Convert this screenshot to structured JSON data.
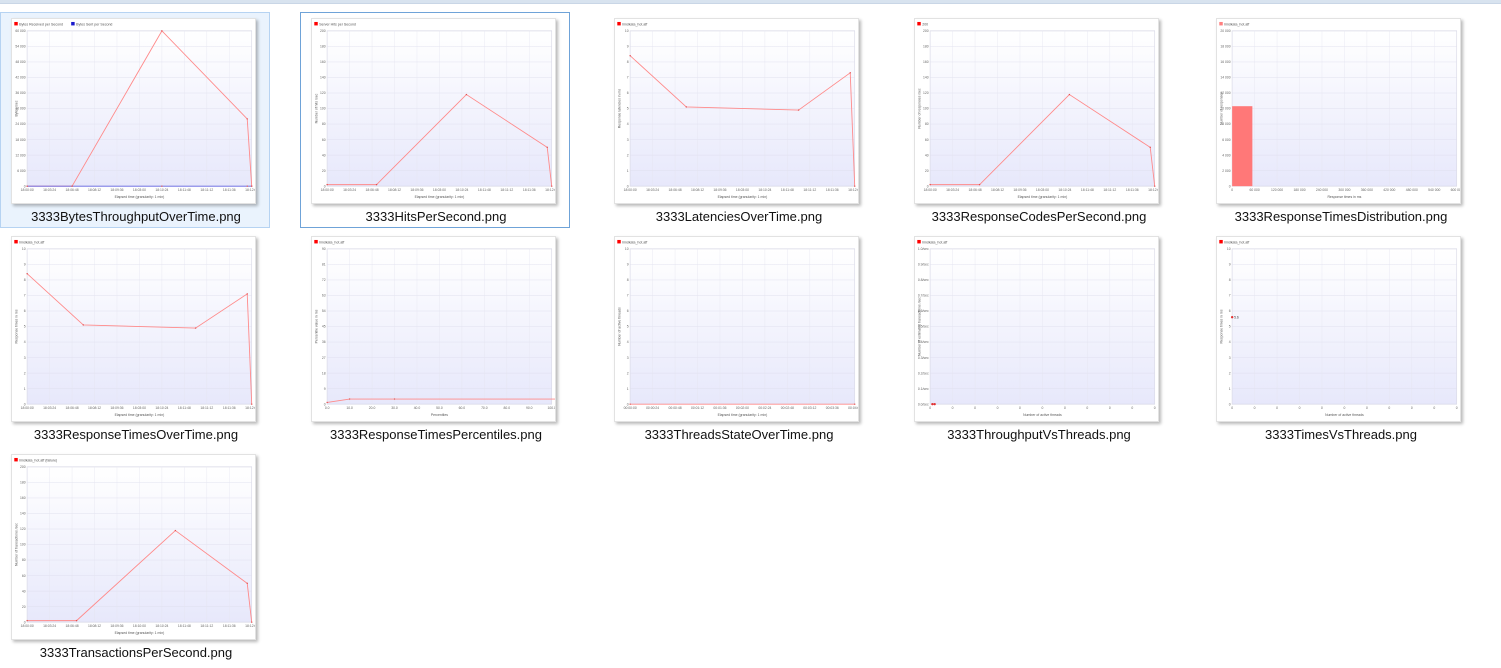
{
  "files": [
    {
      "name": "3333BytesThroughputOverTime.png",
      "state": "selected",
      "chart": {
        "legend": [
          "Bytes Received per Second",
          "Bytes Sent per Second"
        ],
        "legend_colors": [
          "#ff0000",
          "#1a1acc"
        ],
        "y_ticks": [
          "60 000",
          "54 000",
          "48 000",
          "42 000",
          "36 000",
          "30 000",
          "24 000",
          "18 000",
          "12 000",
          "6 000",
          "0"
        ],
        "x_ticks": [
          "18:00:00",
          "18:03:24",
          "18:06:48",
          "18:08:12",
          "18:09:36",
          "18:03:00",
          "18:10:24",
          "18:11:48",
          "18:11:12",
          "18:11:36",
          "18:12:00"
        ],
        "xlabel": "Elapsed time (granularity: 1 min)",
        "ylabel": "Bytes /sec",
        "ymax": 60000,
        "series": [
          {
            "color": "#ff8a8a",
            "x": [
              0,
              2,
              6,
              9.8,
              10
            ],
            "y": [
              0,
              0,
              60000,
              26000,
              0
            ]
          },
          {
            "color": "#6060e0",
            "x": [
              0,
              2,
              6,
              9.8,
              10
            ],
            "y": [
              0,
              0,
              0,
              0,
              0
            ]
          }
        ]
      }
    },
    {
      "name": "3333HitsPerSecond.png",
      "state": "focused",
      "chart": {
        "legend": [
          "Server Hits per Second"
        ],
        "legend_colors": [
          "#ff0000"
        ],
        "y_ticks": [
          "200",
          "180",
          "160",
          "140",
          "120",
          "100",
          "80",
          "60",
          "40",
          "20",
          "0"
        ],
        "x_ticks": [
          "18:00:00",
          "18:03:24",
          "18:06:48",
          "18:08:12",
          "18:09:36",
          "18:03:00",
          "18:10:24",
          "18:11:48",
          "18:11:12",
          "18:11:36",
          "18:12:00"
        ],
        "xlabel": "Elapsed time (granularity: 1 min)",
        "ylabel": "Number of hits /sec",
        "ymax": 200,
        "series": [
          {
            "color": "#ff8a8a",
            "x": [
              0,
              2.2,
              6.2,
              9.8,
              10
            ],
            "y": [
              2,
              2,
              118,
              50,
              0
            ]
          }
        ]
      }
    },
    {
      "name": "3333LatenciesOverTime.png",
      "state": "none",
      "chart": {
        "legend": [
          "limdkata_hot.aff"
        ],
        "legend_colors": [
          "#ff0000"
        ],
        "y_ticks": [
          "10",
          "9",
          "8",
          "7",
          "6",
          "5",
          "4",
          "3",
          "2",
          "1",
          "0"
        ],
        "x_ticks": [
          "18:00:00",
          "18:03:24",
          "18:06:48",
          "18:08:12",
          "18:09:36",
          "18:03:00",
          "18:10:24",
          "18:11:48",
          "18:11:12",
          "18:11:36",
          "18:12:00"
        ],
        "xlabel": "Elapsed time (granularity: 1 min)",
        "ylabel": "Response latencies in ms",
        "ymax": 10,
        "series": [
          {
            "color": "#ff8a8a",
            "x": [
              0,
              2.5,
              7.5,
              9.8,
              10
            ],
            "y": [
              8.4,
              5.1,
              4.9,
              7.3,
              0
            ]
          }
        ]
      }
    },
    {
      "name": "3333ResponseCodesPerSecond.png",
      "state": "none",
      "chart": {
        "legend": [
          "200"
        ],
        "legend_colors": [
          "#ff0000"
        ],
        "y_ticks": [
          "200",
          "180",
          "160",
          "140",
          "120",
          "100",
          "80",
          "60",
          "40",
          "20",
          "0"
        ],
        "x_ticks": [
          "18:00:00",
          "18:03:24",
          "18:06:48",
          "18:08:12",
          "18:09:36",
          "18:03:00",
          "18:10:24",
          "18:11:48",
          "18:11:12",
          "18:11:36",
          "18:12:00"
        ],
        "xlabel": "Elapsed time (granularity: 1 min)",
        "ylabel": "Number of responses /sec",
        "ymax": 200,
        "series": [
          {
            "color": "#ff8a8a",
            "x": [
              0,
              2.2,
              6.2,
              9.8,
              10
            ],
            "y": [
              2,
              2,
              118,
              50,
              0
            ]
          }
        ]
      }
    },
    {
      "name": "3333ResponseTimesDistribution.png",
      "state": "none",
      "chart": {
        "legend": [
          "limdkata_hot.aff"
        ],
        "legend_colors": [
          "#ff8080"
        ],
        "y_ticks": [
          "20 000",
          "18 000",
          "16 000",
          "14 000",
          "12 000",
          "10 000",
          "8 000",
          "6 000",
          "4 000",
          "2 000",
          "0"
        ],
        "x_ticks": [
          "0",
          "60 000",
          "120 000",
          "180 000",
          "240 000",
          "300 000",
          "360 000",
          "420 000",
          "480 000",
          "540 000",
          "600 000"
        ],
        "xlabel": "Response times in ms",
        "ylabel": "Number of responses",
        "ymax": 20000,
        "bar": {
          "x0": 0,
          "x1": 0.9,
          "value": 10300
        }
      }
    },
    {
      "name": "3333ResponseTimesOverTime.png",
      "state": "none",
      "chart": {
        "legend": [
          "limdkata_hot.aff"
        ],
        "legend_colors": [
          "#ff0000"
        ],
        "y_ticks": [
          "10",
          "9",
          "8",
          "7",
          "6",
          "5",
          "4",
          "3",
          "2",
          "1",
          "0"
        ],
        "x_ticks": [
          "18:00:00",
          "18:03:24",
          "18:06:48",
          "18:08:12",
          "18:09:36",
          "18:03:00",
          "18:10:24",
          "18:11:48",
          "18:11:12",
          "18:11:36",
          "18:12:00"
        ],
        "xlabel": "Elapsed time (granularity: 1 min)",
        "ylabel": "Response times in ms",
        "ymax": 10,
        "series": [
          {
            "color": "#ff8a8a",
            "x": [
              0,
              2.5,
              7.5,
              9.8,
              10
            ],
            "y": [
              8.4,
              5.1,
              4.9,
              7.1,
              0
            ]
          }
        ]
      }
    },
    {
      "name": "3333ResponseTimesPercentiles.png",
      "state": "none",
      "chart": {
        "legend": [
          "limdkata_hot.aff"
        ],
        "legend_colors": [
          "#ff0000"
        ],
        "y_ticks": [
          "90",
          "81",
          "72",
          "63",
          "54",
          "45",
          "36",
          "27",
          "18",
          "9",
          "0"
        ],
        "x_ticks": [
          "0.0",
          "10.0",
          "20.0",
          "30.0",
          "40.0",
          "50.0",
          "60.0",
          "70.0",
          "80.0",
          "90.0",
          "100.0"
        ],
        "xlabel": "Percentiles",
        "ylabel": "Percentile value in ms",
        "ymax": 90,
        "series": [
          {
            "color": "#ff8a8a",
            "x": [
              0,
              1,
              3,
              27,
              28,
              79,
              80,
              97,
              99,
              99.6,
              100
            ],
            "y": [
              1,
              3,
              3,
              3,
              4,
              4,
              5,
              5,
              10,
              86,
              0
            ]
          }
        ]
      }
    },
    {
      "name": "3333ThreadsStateOverTime.png",
      "state": "none",
      "chart": {
        "legend": [
          "limdkata_hot.aff"
        ],
        "legend_colors": [
          "#ff0000"
        ],
        "y_ticks": [
          "10",
          "9",
          "8",
          "7",
          "6",
          "5",
          "4",
          "3",
          "2",
          "1",
          "0"
        ],
        "x_ticks": [
          "00:00:00",
          "00:00:24",
          "00:00:48",
          "00:01:12",
          "00:01:36",
          "00:02:00",
          "00:02:24",
          "00:02:48",
          "00:03:12",
          "00:03:36",
          "00:04:00"
        ],
        "xlabel": "Elapsed time (granularity: 1 min)",
        "ylabel": "Number of active threads",
        "ymax": 10,
        "series": [
          {
            "color": "#ff8a8a",
            "x": [
              0,
              10
            ],
            "y": [
              0,
              0
            ]
          }
        ]
      }
    },
    {
      "name": "3333ThroughputVsThreads.png",
      "state": "none",
      "chart": {
        "legend": [
          "limdkata_hot.aff"
        ],
        "legend_colors": [
          "#ff0000"
        ],
        "y_ticks": [
          "1.0/sec",
          "0.9/sec",
          "0.8/sec",
          "0.7/sec",
          "0.6/sec",
          "0.5/sec",
          "0.4/sec",
          "0.3/sec",
          "0.2/sec",
          "0.1/sec",
          "0.0/sec"
        ],
        "x_ticks": [
          "0",
          "0",
          "0",
          "0",
          "0",
          "0",
          "0",
          "0",
          "0",
          "0",
          "0"
        ],
        "xlabel": "Number of active threads",
        "ylabel": "Number of estimated transactions /sec",
        "ymax": 10,
        "points": [
          {
            "x": 0.1,
            "y": 0
          },
          {
            "x": 0.2,
            "y": 0
          }
        ]
      }
    },
    {
      "name": "3333TimesVsThreads.png",
      "state": "none",
      "chart": {
        "legend": [
          "limdkata_hot.aff"
        ],
        "legend_colors": [
          "#ff0000"
        ],
        "y_ticks": [
          "10",
          "9",
          "8",
          "7",
          "6",
          "5",
          "4",
          "3",
          "2",
          "1",
          "0"
        ],
        "x_ticks": [
          "0",
          "0",
          "0",
          "0",
          "0",
          "0",
          "0",
          "0",
          "0",
          "0",
          "0"
        ],
        "xlabel": "Number of active threads",
        "ylabel": "Response times in ms",
        "ymax": 10,
        "points": [
          {
            "x": 0,
            "y": 5.6,
            "label": "5.6"
          }
        ]
      }
    },
    {
      "name": "3333TransactionsPerSecond.png",
      "state": "none",
      "chart": {
        "legend": [
          "limdkata_hot.aff (failure)"
        ],
        "legend_colors": [
          "#ff0000"
        ],
        "y_ticks": [
          "200",
          "180",
          "160",
          "140",
          "120",
          "100",
          "80",
          "60",
          "40",
          "20",
          "0"
        ],
        "x_ticks": [
          "18:00:00",
          "18:03:24",
          "18:06:48",
          "18:08:12",
          "18:09:36",
          "18:10:00",
          "18:10:24",
          "18:11:48",
          "18:11:12",
          "18:11:36",
          "18:12:00"
        ],
        "xlabel": "Elapsed time (granularity: 1 min)",
        "ylabel": "Number of transactions /sec",
        "ymax": 200,
        "series": [
          {
            "color": "#ff8a8a",
            "x": [
              0,
              2.2,
              6.6,
              9.8,
              10
            ],
            "y": [
              2,
              2,
              118,
              50,
              0
            ]
          }
        ]
      }
    }
  ]
}
